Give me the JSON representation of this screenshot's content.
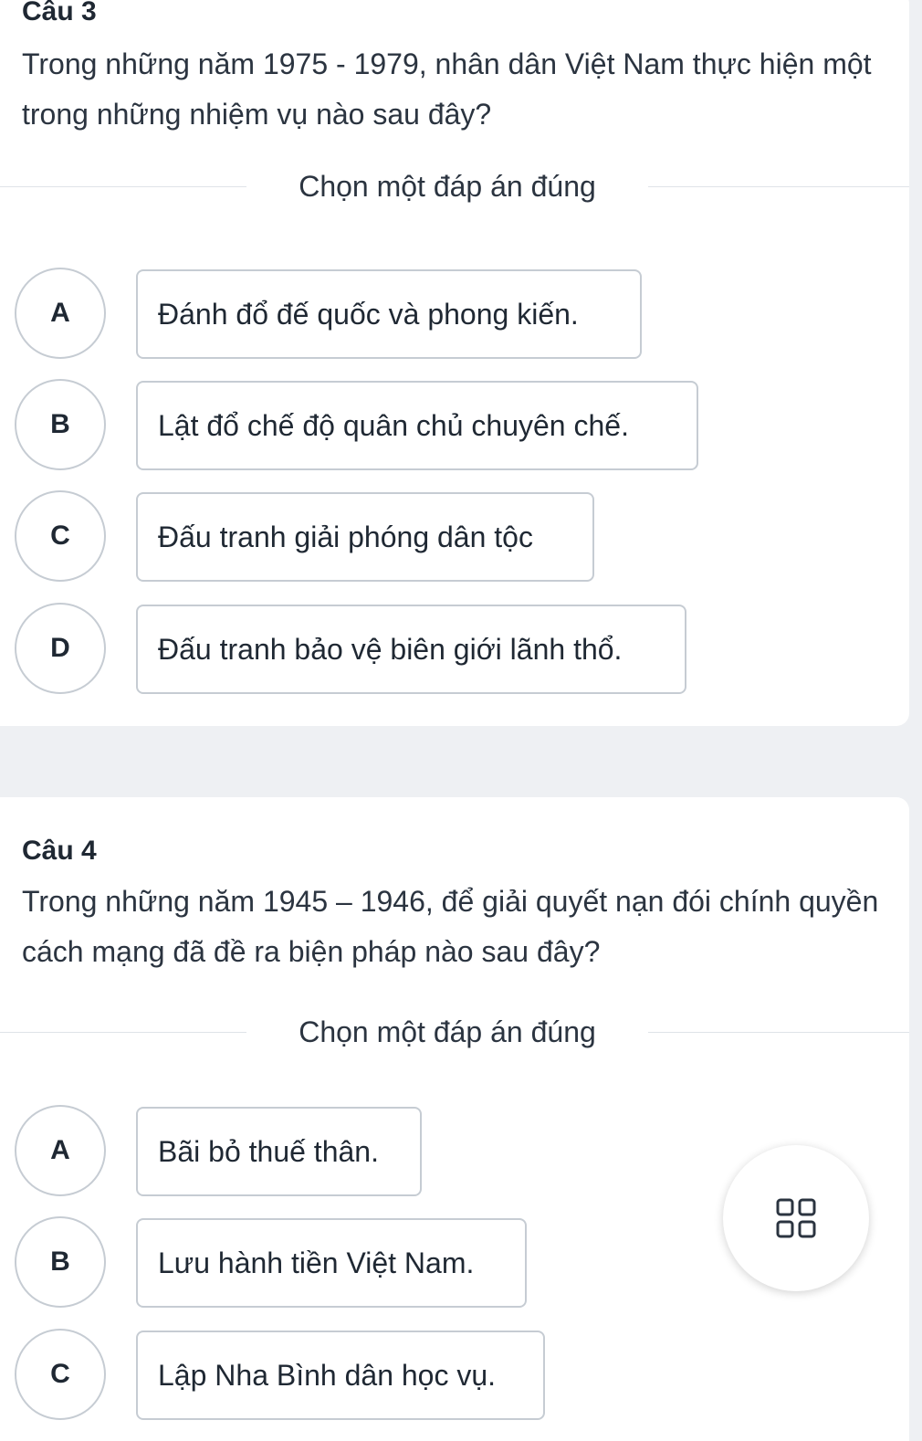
{
  "questions": [
    {
      "title": "Câu 3",
      "text": "Trong những năm 1975 - 1979, nhân dân Việt Nam thực hiện một trong những nhiệm vụ nào sau đây?",
      "instruction": "Chọn một đáp án đúng",
      "options": [
        {
          "letter": "A",
          "text": "Đánh đổ đế quốc và phong kiến."
        },
        {
          "letter": "B",
          "text": "Lật đổ chế độ quân chủ chuyên chế."
        },
        {
          "letter": "C",
          "text": "Đấu tranh giải phóng dân tộc"
        },
        {
          "letter": "D",
          "text": "Đấu tranh bảo vệ biên giới lãnh thổ."
        }
      ]
    },
    {
      "title": "Câu 4",
      "text": "Trong những năm 1945 – 1946, để giải quyết nạn đói chính quyền cách mạng đã đề ra biện pháp nào sau đây?",
      "instruction": "Chọn một đáp án đúng",
      "options": [
        {
          "letter": "A",
          "text": "Bãi bỏ thuế thân."
        },
        {
          "letter": "B",
          "text": "Lưu hành tiền Việt Nam."
        },
        {
          "letter": "C",
          "text": "Lập Nha Bình dân học vụ."
        }
      ]
    }
  ],
  "fab": {
    "icon": "grid-icon"
  },
  "colors": {
    "border": "#c6ccd3",
    "background": "#eef0f3",
    "card": "#ffffff",
    "text": "#1f2833"
  }
}
